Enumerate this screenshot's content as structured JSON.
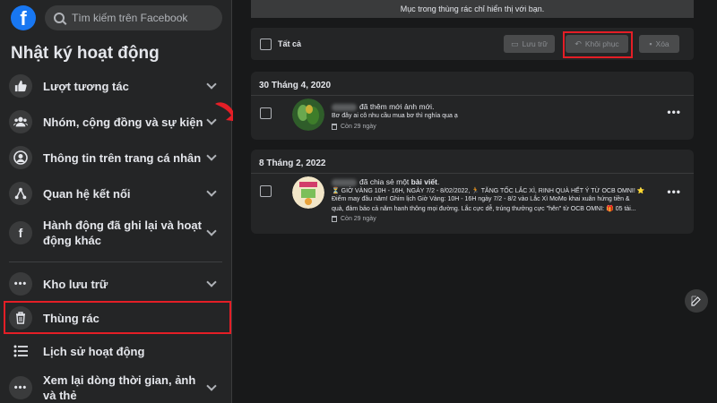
{
  "search": {
    "placeholder": "Tìm kiếm trên Facebook"
  },
  "sidebar": {
    "title": "Nhật ký hoạt động",
    "items": [
      {
        "label": "Lượt tương tác",
        "icon": "thumbs-up-icon"
      },
      {
        "label": "Nhóm, cộng đồng và sự kiện",
        "icon": "group-icon"
      },
      {
        "label": "Thông tin trên trang cá nhân",
        "icon": "profile-icon"
      },
      {
        "label": "Quan hệ kết nối",
        "icon": "connections-icon"
      },
      {
        "label": "Hành động đã ghi lại và hoạt động khác",
        "icon": "facebook-icon"
      }
    ],
    "more_items": [
      {
        "label": "Kho lưu trữ",
        "icon": "more-dots-icon"
      },
      {
        "label": "Thùng rác",
        "icon": "trash-icon"
      },
      {
        "label": "Lịch sử hoạt động",
        "icon": "list-icon"
      },
      {
        "label": "Xem lại dòng thời gian, ảnh và thẻ",
        "icon": "more-dots-icon"
      }
    ]
  },
  "main": {
    "notice": "Mục trong thùng rác chỉ hiển thị với bạn.",
    "toolbar": {
      "select_all": "Tất cả",
      "archive": "Lưu trữ",
      "restore": "Khôi phục",
      "delete": "Xóa"
    },
    "entries": [
      {
        "date": "30 Tháng 4, 2020",
        "action": "đã thêm mới ảnh mới.",
        "subtext": "Bơ đây ai cô nhu cầu mua bơ thì nghía qua ạ",
        "meta": "Còn 29 ngày"
      },
      {
        "date": "8 Tháng 2, 2022",
        "action_prefix": "đã chia sẻ một ",
        "action_bold": "bài viết",
        "action_suffix": ".",
        "lines": [
          "⏳ GIỜ VÀNG 10H - 16H, NGÀY 7/2 - 8/02/2022, 🏃 TĂNG TỐC LẮC XÌ, RINH QUÀ HẾT Ý TỪ OCB OMNI! ⭐",
          "Điểm may đầu năm! Ghim lịch Giờ Vàng: 10H - 16H ngày 7/2 - 8/2 vào Lắc Xì MoMo khai xuân hứng tiền &",
          "quà, đảm bảo cả năm hanh thông mọi đường. Lắc cực dễ, trúng thưởng cực \"hên\" từ OCB OMNI: 🎁 05 tài..."
        ],
        "meta": "Còn 29 ngày"
      }
    ]
  },
  "colors": {
    "accent": "#1877f2",
    "highlight": "#e41e26",
    "background": "#18191a",
    "panel": "#242526"
  }
}
